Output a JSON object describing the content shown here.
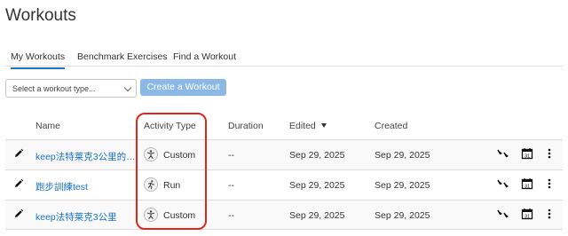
{
  "page": {
    "title": "Workouts"
  },
  "tabs": [
    {
      "label": "My Workouts",
      "active": true
    },
    {
      "label": "Benchmark Exercises",
      "active": false
    },
    {
      "label": "Find a Workout",
      "active": false
    }
  ],
  "filter": {
    "selected": "Select a workout type..."
  },
  "create_button": {
    "label": "Create a Workout",
    "color": "#8cb8e6"
  },
  "table": {
    "columns": {
      "name": "Name",
      "activity_type": "Activity Type",
      "duration": "Duration",
      "edited": "Edited",
      "created": "Created"
    },
    "sort": {
      "column": "edited",
      "direction": "desc"
    },
    "rows": [
      {
        "name": "keep法特莱克3公里的副...",
        "activity_type": "Custom",
        "activity_icon": "custom-activity-icon",
        "duration": "--",
        "edited": "Sep 29, 2025",
        "created": "Sep 29, 2025"
      },
      {
        "name": "跑步訓練test",
        "activity_type": "Run",
        "activity_icon": "run-activity-icon",
        "duration": "--",
        "edited": "Sep 29, 2025",
        "created": "Sep 29, 2025"
      },
      {
        "name": "keep法特莱克3公里",
        "activity_type": "Custom",
        "activity_icon": "custom-activity-icon",
        "duration": "--",
        "edited": "Sep 29, 2025",
        "created": "Sep 29, 2025"
      }
    ]
  },
  "colors": {
    "link": "#1a73c7",
    "tab_active": "#1a73c7",
    "highlight": "#e0271e"
  }
}
